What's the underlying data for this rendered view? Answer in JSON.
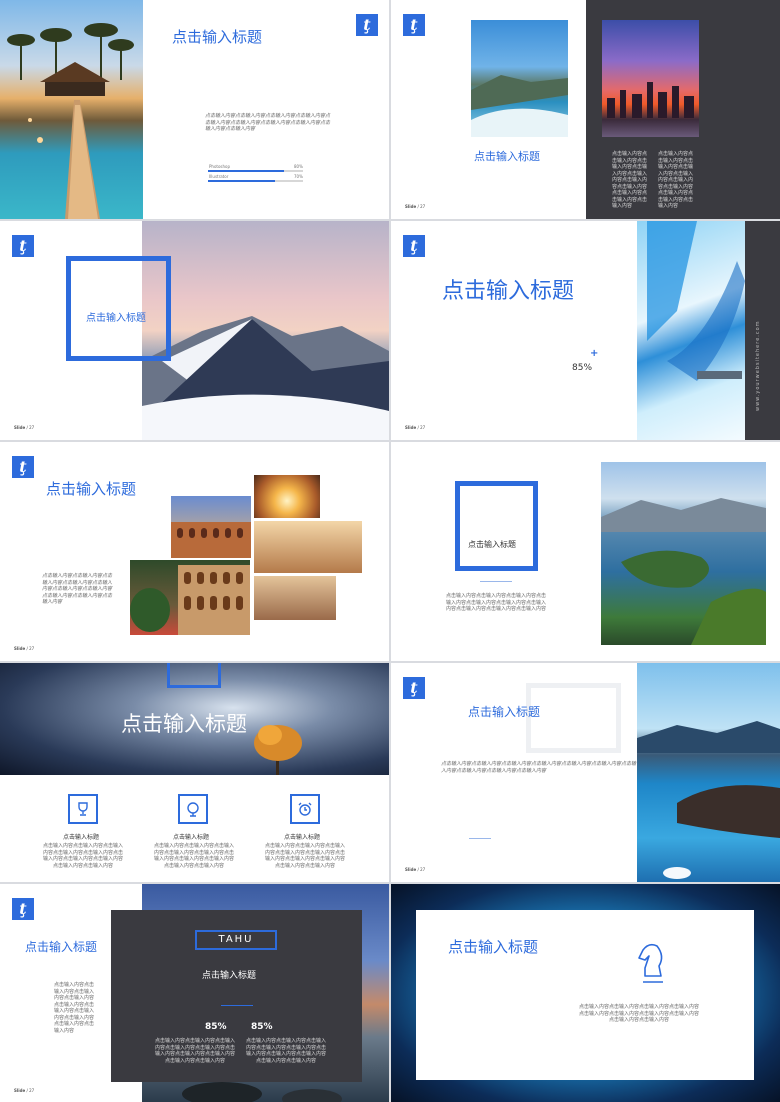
{
  "brand": {
    "blue": "#2d6bdc",
    "dark": "#3a3a40"
  },
  "logo_glyph": "ţ",
  "title": "点击输入标题",
  "body": "点击输入内容点击输入内容点击输入内容点击输入内容点击输入内容点击输入内容点击输入内容点击输入内容点击输入内容点击输入内容",
  "slide_label": "Slide",
  "slide_suffix": "/ 27",
  "s1": {
    "bars": [
      {
        "label": "Photoshop",
        "value": "80%",
        "fraction": 0.8
      },
      {
        "label": "Illustrator",
        "value": "70%",
        "fraction": 0.7
      }
    ]
  },
  "s4": {
    "percent": "85%",
    "url": "www.yourwebsitehere.com",
    "plus": "+"
  },
  "s10": {
    "tag": "TAHU",
    "percents": [
      "85%",
      "85%"
    ]
  }
}
